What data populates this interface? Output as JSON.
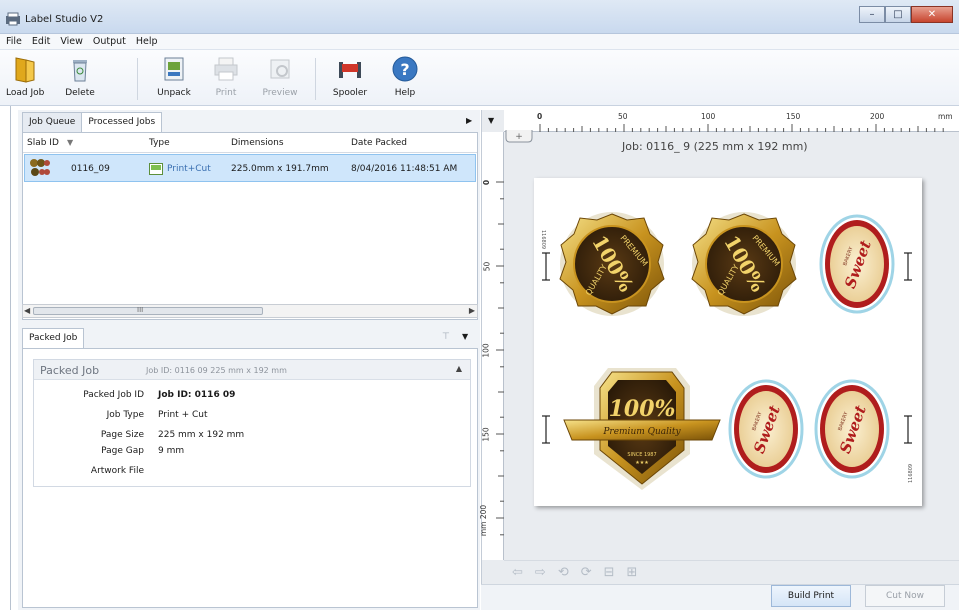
{
  "window": {
    "title": "Label Studio V2"
  },
  "menu": {
    "items": [
      "File",
      "Edit",
      "View",
      "Output",
      "Help"
    ]
  },
  "toolbar": {
    "load_job": "Load Job",
    "delete": "Delete",
    "unpack": "Unpack",
    "print": "Print",
    "preview": "Preview",
    "spooler": "Spooler",
    "help": "Help"
  },
  "left": {
    "tabs": [
      "Job Queue",
      "Processed Jobs"
    ],
    "columns": [
      "Slab ID",
      "Type",
      "Dimensions",
      "Date Packed"
    ],
    "rows": [
      {
        "slab_id": "0116_09",
        "type": "Print+Cut",
        "dimensions": "225.0mm x 191.7mm",
        "date_packed": "8/04/2016 11:48:51 AM"
      }
    ],
    "scroll_mark": "III"
  },
  "packed": {
    "tab": "Packed Job",
    "header_title": "Packed Job",
    "header_sub": "Job ID: 0116 09  225 mm x 192 mm",
    "fields": [
      {
        "key": "Packed Job ID",
        "value": "Job ID: 0116 09"
      },
      {
        "key": "Job Type",
        "value": "Print + Cut"
      },
      {
        "key": "Page Size",
        "value": "225 mm x 192 mm"
      },
      {
        "key": "Page Gap",
        "value": "9 mm"
      },
      {
        "key": "Artwork File",
        "value": ""
      }
    ]
  },
  "preview": {
    "job_title": "Job: 0116_ 9  (225 mm x 192 mm)",
    "hruler": [
      "0",
      "50",
      "100",
      "150",
      "200",
      "mm"
    ],
    "vruler": [
      "0",
      "50",
      "100",
      "150",
      "mm 200"
    ],
    "labels": {
      "quality": "QUALITY",
      "premium": "PREMIUM",
      "hundred": "100%",
      "sweet": "Sweet",
      "bakery": "BAKERY",
      "premium_quality": "Premium Quality",
      "since": "SINCE 1987",
      "stars": "★★★",
      "side_code": "116809"
    }
  },
  "bottom": {
    "build_print": "Build Print",
    "cut_now": "Cut Now"
  }
}
